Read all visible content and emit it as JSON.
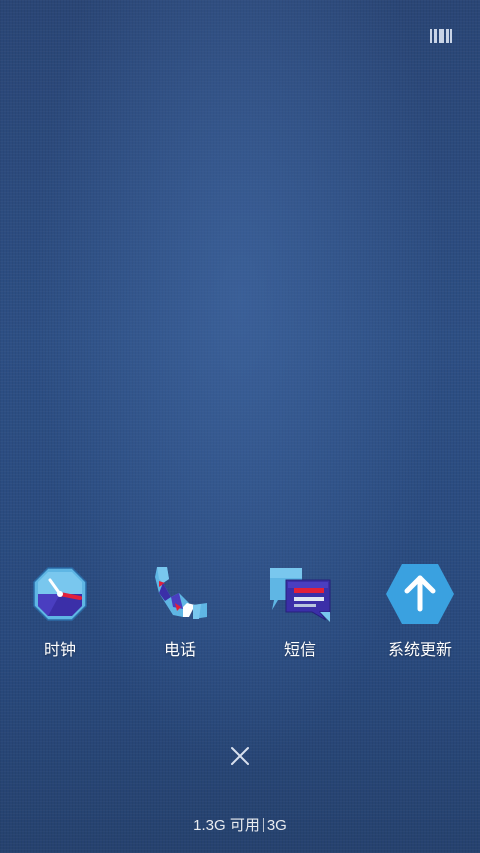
{
  "top_bar": {
    "recents_icon": "barcode-icon"
  },
  "recent_apps": [
    {
      "label": "时钟",
      "icon": "clock-icon"
    },
    {
      "label": "电话",
      "icon": "phone-icon"
    },
    {
      "label": "短信",
      "icon": "message-icon"
    },
    {
      "label": "系统更新",
      "icon": "arrow-up-icon",
      "color": "#3aa1e0"
    }
  ],
  "bottom": {
    "close_icon": "close-icon",
    "memory_available": "1.3G 可用",
    "memory_total": "3G"
  },
  "colors": {
    "background": "#2b4a7c",
    "update_icon": "#3aa1e0",
    "text": "#ffffff"
  }
}
